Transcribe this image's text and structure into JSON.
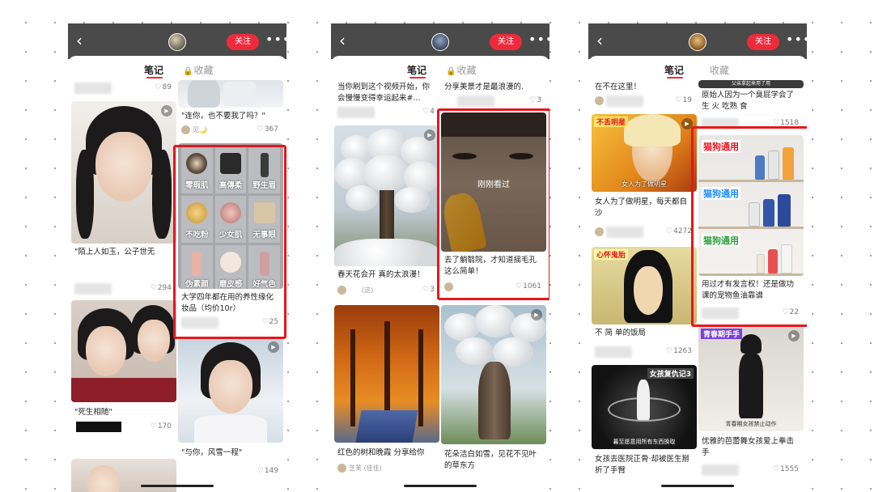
{
  "colors": {
    "accent": "#ee2b3c",
    "highlight": "#e8161c",
    "topbar": "#4a4a4a"
  },
  "icons": {
    "back": "chevron-left-icon",
    "more": "more-dots-icon",
    "heart": "heart-icon",
    "lock": "lock-icon",
    "play": "play-icon"
  },
  "phones": [
    {
      "follow_label": "关注",
      "tab_notes": "笔记",
      "tab_fav": "收藏",
      "cards": {
        "l0_likes": "89",
        "l1_caption": "\"陌上人如玉，公子世无",
        "l1_likes": "294",
        "l2_caption": "\"死生相随\"",
        "l2_likes": "170",
        "r0_caption": "\"连你，也不要我了吗？\"",
        "r0_user": "见🌙",
        "r0_likes": "367",
        "r1_grid": [
          "零瑕肌",
          "高傳柔",
          "野生眉",
          "不吃粉",
          "少女肌",
          "无事眼",
          "伪素颜",
          "磨皮感",
          "好气色"
        ],
        "r1_caption": "大学四年都在用的养性缘化妆品（均价10r）",
        "r1_likes": "25",
        "r2_caption": "\"与你，风雪一程\"",
        "r2_likes": "149"
      }
    },
    {
      "follow_label": "关注",
      "tab_notes": "笔记",
      "tab_fav": "收藏",
      "cards": {
        "l0_caption": "当你刷到这个视频开始，你会慢慢变得幸运起来#...",
        "l0_likes": "4",
        "l1_caption": "春天花会开 真的太浪漫！",
        "l1_user": "(这)",
        "l1_likes": "3",
        "l2_caption": "红色的树和晚霞 分享给你",
        "l2_user": "芝芙 (佳佳)",
        "r0_caption": "分享美景才是最浪漫的.",
        "r0_likes": "3",
        "r1_overlay": "刚刚看过",
        "r1_caption": "去了躺翳院，才知道揺毛孔这么简单！",
        "r1_likes": "1061",
        "r2_caption": "花朵洁白如雪，见花不见叶的草东方"
      }
    },
    {
      "follow_label": "关注",
      "tab_notes": "笔记",
      "tab_fav": "收藏",
      "cards": {
        "l0_caption": "在不在这里！",
        "l0_likes": "19",
        "l1_badge": "不丢明星",
        "l1_overlay": "女人为了做明星",
        "l1_caption": "女人为了做明星，每天都自沙",
        "l1_likes": "4272",
        "l2_badge": "心怀鬼胎",
        "l2_caption": "不 简 单的饭局",
        "l2_likes": "1263",
        "l3_badge": "女孩复仇记3",
        "l3_overlay": "暮至愿意用所有东西换取",
        "l3_caption": "女孩去医院正骨·却被医生掰折了手臂",
        "r0_banner": "父亲拿起来用了用",
        "r0_caption": "原始人因为一个臭屁学会了 生 火 吃熟 食",
        "r0_likes": "1518",
        "r1_tags": [
          "猫狗通用",
          "猫狗通用",
          "猫狗通用"
        ],
        "r1_caption": "用过才有发言权！还是做功课的宠物鱼油靠谱",
        "r1_likes": "22",
        "r2_badge": "青春期手手",
        "r2_overlay": "青春期女孩禁止动作",
        "r2_caption": "优雅的芭蕾舞女孩爱上拳击手",
        "r2_likes": "1555"
      }
    }
  ]
}
